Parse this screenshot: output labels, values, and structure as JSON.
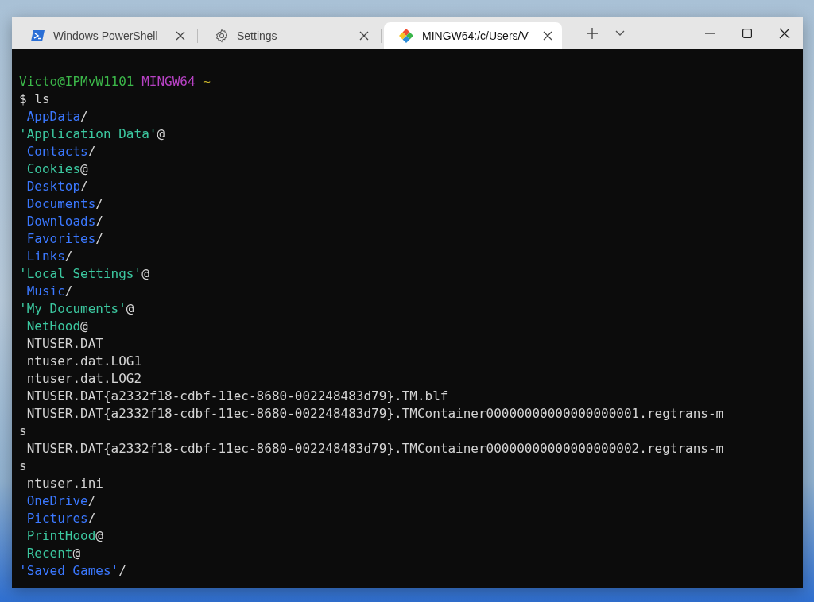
{
  "tabs": [
    {
      "title": "Windows PowerShell",
      "kind": "shell",
      "selected": false
    },
    {
      "title": "Settings",
      "kind": "settings",
      "selected": false
    },
    {
      "title": "MINGW64:/c/Users/V",
      "kind": "bash",
      "selected": true
    }
  ],
  "prompt": {
    "user_host": "Victo@IPMvW1101",
    "system": "MINGW64",
    "path": "~"
  },
  "command": "$ ls",
  "entries": [
    {
      "name": "AppData",
      "kind": "dir",
      "suffix": "/",
      "indent": true
    },
    {
      "name": "'Application Data'",
      "kind": "link",
      "suffix": "@",
      "indent": false
    },
    {
      "name": "Contacts",
      "kind": "dir",
      "suffix": "/",
      "indent": true
    },
    {
      "name": "Cookies",
      "kind": "link",
      "suffix": "@",
      "indent": true
    },
    {
      "name": "Desktop",
      "kind": "dir",
      "suffix": "/",
      "indent": true
    },
    {
      "name": "Documents",
      "kind": "dir",
      "suffix": "/",
      "indent": true
    },
    {
      "name": "Downloads",
      "kind": "dir",
      "suffix": "/",
      "indent": true
    },
    {
      "name": "Favorites",
      "kind": "dir",
      "suffix": "/",
      "indent": true
    },
    {
      "name": "Links",
      "kind": "dir",
      "suffix": "/",
      "indent": true
    },
    {
      "name": "'Local Settings'",
      "kind": "link",
      "suffix": "@",
      "indent": false
    },
    {
      "name": "Music",
      "kind": "dir",
      "suffix": "/",
      "indent": true
    },
    {
      "name": "'My Documents'",
      "kind": "link",
      "suffix": "@",
      "indent": false
    },
    {
      "name": "NetHood",
      "kind": "link",
      "suffix": "@",
      "indent": true
    },
    {
      "name": "NTUSER.DAT",
      "kind": "file",
      "indent": true
    },
    {
      "name": "ntuser.dat.LOG1",
      "kind": "file",
      "indent": true
    },
    {
      "name": "ntuser.dat.LOG2",
      "kind": "file",
      "indent": true
    },
    {
      "name": "NTUSER.DAT{a2332f18-cdbf-11ec-8680-002248483d79}.TM.blf",
      "kind": "file",
      "indent": true
    },
    {
      "name": "NTUSER.DAT{a2332f18-cdbf-11ec-8680-002248483d79}.TMContainer00000000000000000001.regtrans-m",
      "kind": "file",
      "indent": true
    },
    {
      "name": "s",
      "kind": "file",
      "indent": false
    },
    {
      "name": "NTUSER.DAT{a2332f18-cdbf-11ec-8680-002248483d79}.TMContainer00000000000000000002.regtrans-m",
      "kind": "file",
      "indent": true
    },
    {
      "name": "s",
      "kind": "file",
      "indent": false
    },
    {
      "name": "ntuser.ini",
      "kind": "file",
      "indent": true
    },
    {
      "name": "OneDrive",
      "kind": "dir",
      "suffix": "/",
      "indent": true
    },
    {
      "name": "Pictures",
      "kind": "dir",
      "suffix": "/",
      "indent": true
    },
    {
      "name": "PrintHood",
      "kind": "link",
      "suffix": "@",
      "indent": true
    },
    {
      "name": "Recent",
      "kind": "link",
      "suffix": "@",
      "indent": true
    },
    {
      "name": "'Saved Games'",
      "kind": "dir",
      "suffix": "/",
      "indent": false
    }
  ]
}
